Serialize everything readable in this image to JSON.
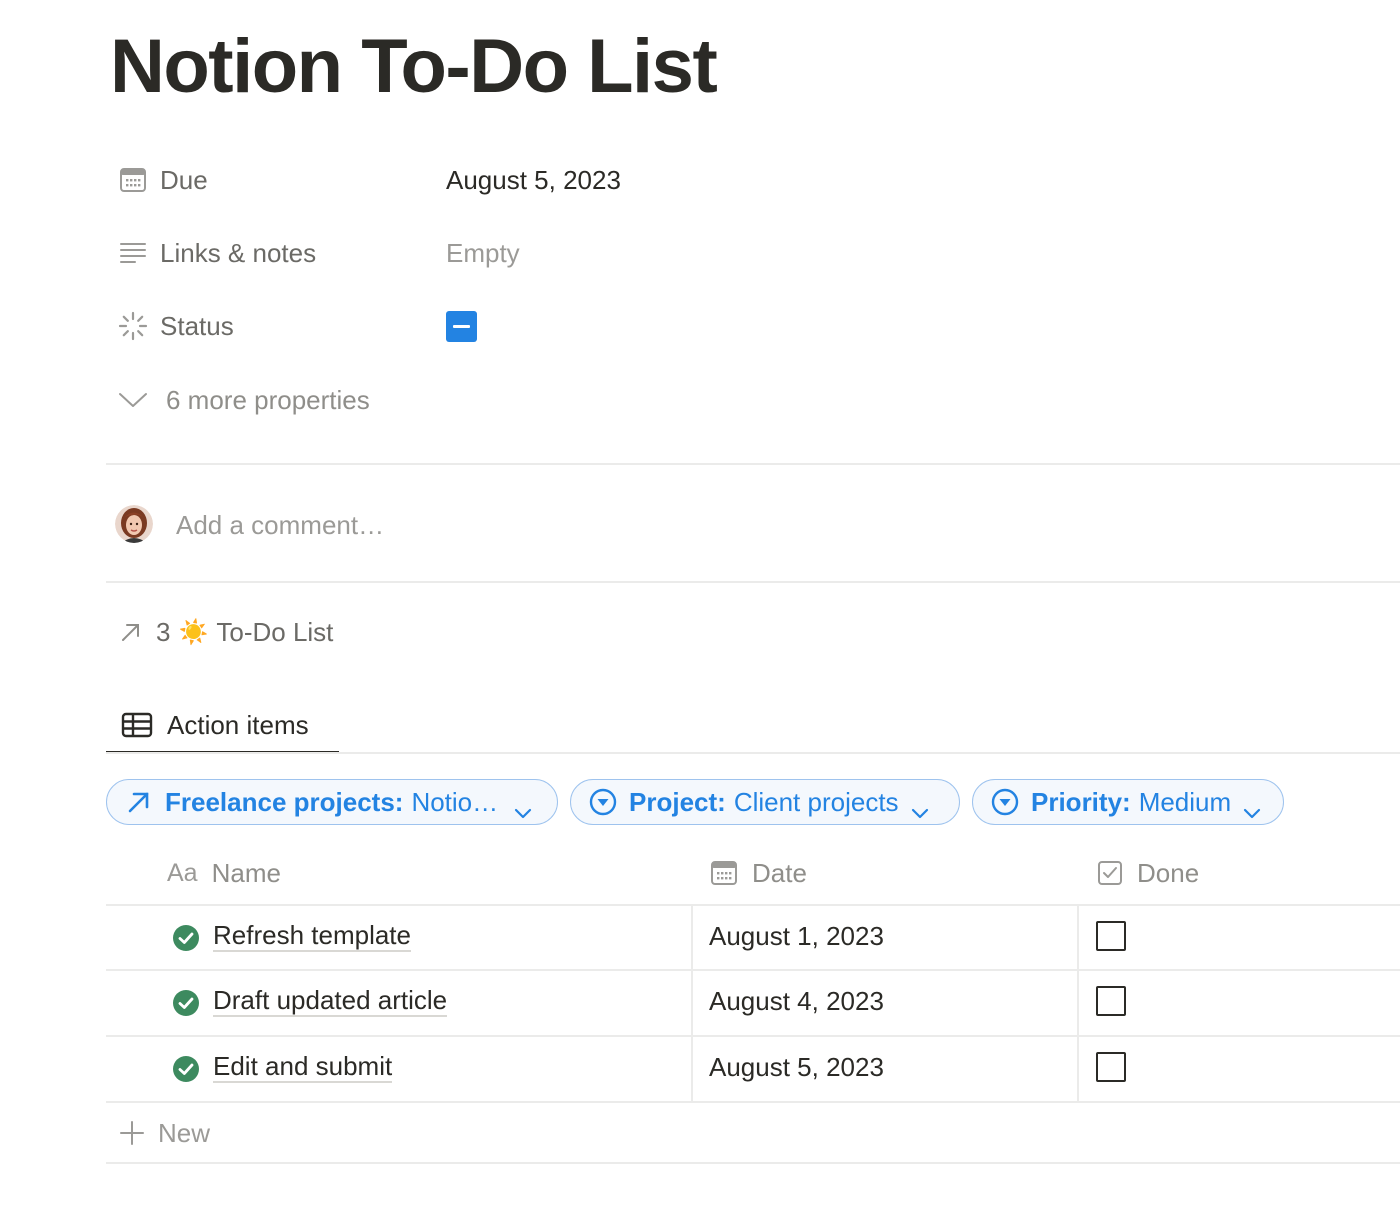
{
  "page": {
    "title": "Notion To-Do List"
  },
  "properties": [
    {
      "icon": "calendar-icon",
      "label": "Due",
      "value": "August 5, 2023"
    },
    {
      "icon": "text-lines-icon",
      "label": "Links & notes",
      "value": "Empty"
    },
    {
      "icon": "status-spinner-icon",
      "label": "Status",
      "value": ""
    }
  ],
  "more_properties": "6 more properties",
  "comment": {
    "avatar": "user-avatar",
    "placeholder": "Add a comment…"
  },
  "relation": {
    "count": "3",
    "emoji": "☀️",
    "label": "To-Do List"
  },
  "view": {
    "tab_label": "Action items"
  },
  "filters": [
    {
      "icon": "arrow-up-right-icon",
      "key": "Freelance projects:",
      "value": "Notio…"
    },
    {
      "icon": "circle-chevron-down-icon",
      "key": "Project:",
      "value": "Client projects"
    },
    {
      "icon": "circle-chevron-down-icon",
      "key": "Priority:",
      "value": "Medium"
    }
  ],
  "table": {
    "columns": [
      {
        "icon_text": "Aa",
        "label": "Name"
      },
      {
        "icon": "calendar-icon",
        "label": "Date"
      },
      {
        "icon": "checkbox-icon",
        "label": "Done"
      }
    ],
    "rows": [
      {
        "name": "Refresh template",
        "date": "August 1, 2023",
        "done": false
      },
      {
        "name": "Draft updated article",
        "date": "August 4, 2023",
        "done": false
      },
      {
        "name": "Edit and submit",
        "date": "August 5, 2023",
        "done": false
      }
    ],
    "new_label": "New"
  },
  "colors": {
    "accent": "#2383e2",
    "text": "#2b2a26",
    "muted": "#8f8e8a",
    "check_green": "#3d8a5f"
  }
}
